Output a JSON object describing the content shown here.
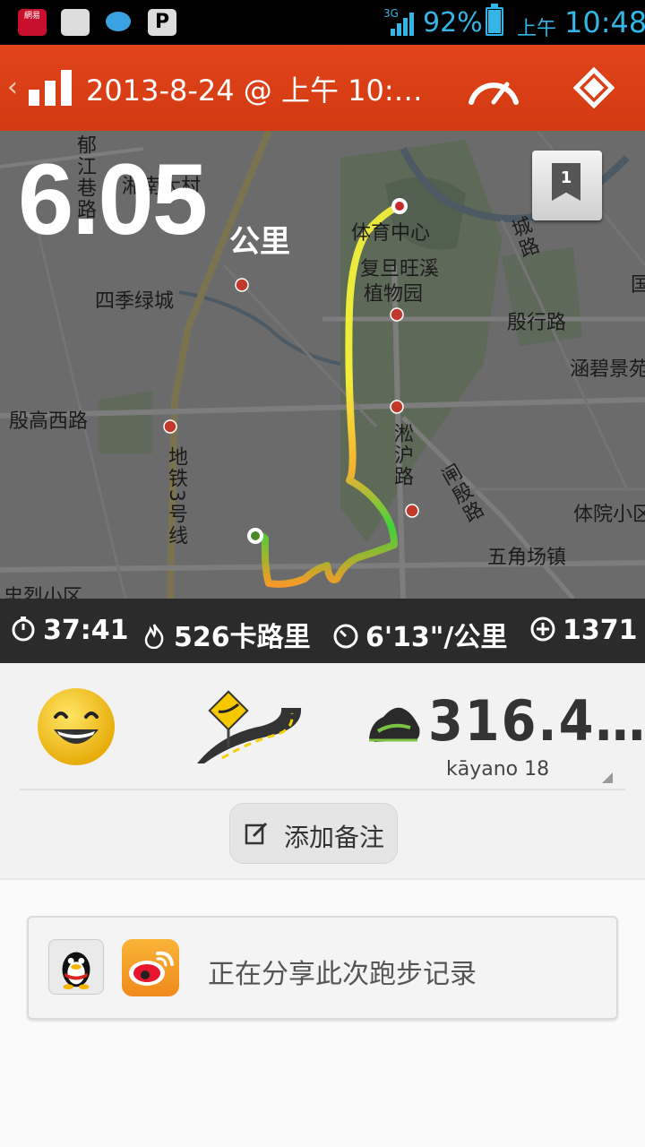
{
  "status_bar": {
    "netease_label": "網易",
    "network": "3G",
    "battery_percent": "92%",
    "battery_level": 0.92,
    "ampm": "上午",
    "time": "10:48"
  },
  "app_bar": {
    "back_glyph": "‹",
    "title": "2013-8-24 @ 上午 10:…",
    "icons": [
      "bar-chart-icon",
      "speedometer-icon",
      "diamond-route-icon"
    ]
  },
  "run": {
    "distance": "6.05",
    "distance_unit": "公里",
    "lap_badge": "1"
  },
  "map_labels": [
    {
      "text": "郁江巷路"
    },
    {
      "text": "湘南大村"
    },
    {
      "text": "体育中心"
    },
    {
      "text": "复旦旺溪"
    },
    {
      "text": "植物园"
    },
    {
      "text": "四季绿城"
    },
    {
      "text": "殷行路"
    },
    {
      "text": "涵碧景苑"
    },
    {
      "text": "殷高西路"
    },
    {
      "text": "淞沪路"
    },
    {
      "text": "闸殷路"
    },
    {
      "text": "地铁3号线"
    },
    {
      "text": "体院小区"
    },
    {
      "text": "五角场镇"
    },
    {
      "text": "忠烈小区"
    },
    {
      "text": "城路"
    },
    {
      "text": "国"
    }
  ],
  "stats": {
    "duration": "37:41",
    "calories": "526卡路里",
    "pace": "6'13\"/公里",
    "fuel": "1371"
  },
  "summary": {
    "mood_icon": "smiley-icon",
    "terrain_icon": "road-icon",
    "shoe_distance": "316.4…",
    "shoe_name": "kāyano 18",
    "add_note_label": "添加备注"
  },
  "share": {
    "text": "正在分享此次跑步记录",
    "icons": [
      "qq-icon",
      "weibo-icon"
    ]
  },
  "colors": {
    "app_bar": "#d23a11",
    "status_text": "#33b5e5",
    "stats_bg": "#2b2b2b"
  }
}
